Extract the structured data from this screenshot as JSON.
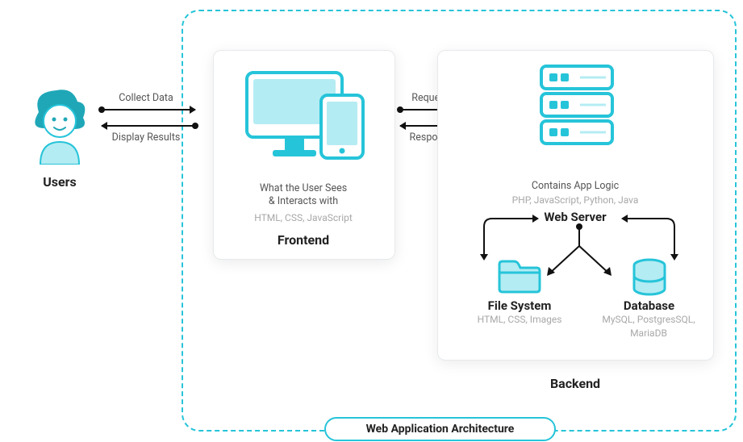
{
  "title": "Web Application Architecture",
  "users": {
    "label": "Users"
  },
  "arrows": {
    "users_to_frontend": "Collect Data",
    "frontend_to_users": "Display Results",
    "frontend_to_backend": "Request",
    "backend_to_frontend": "Response"
  },
  "frontend": {
    "desc_line_1": "What the User Sees",
    "desc_line_2": "& Interacts with",
    "tech": "HTML, CSS, JavaScript",
    "label": "Frontend"
  },
  "backend": {
    "label": "Backend",
    "desc": "Contains App Logic",
    "server_tech": "PHP, JavaScript, Python, Java",
    "server_label": "Web Server",
    "file_system": {
      "label": "File System",
      "tech": "HTML, CSS, Images"
    },
    "database": {
      "label": "Database",
      "tech": "MySQL, PostgresSQL, MariaDB"
    }
  },
  "colors": {
    "accent": "#26c4d9",
    "accent_dark": "#1fa7b8",
    "accent_light": "#b4ecf3"
  }
}
